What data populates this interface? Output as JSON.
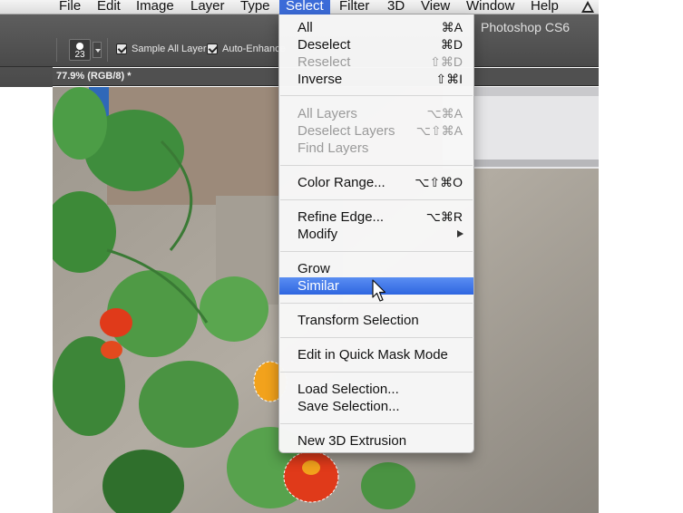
{
  "menubar": {
    "items": [
      "File",
      "Edit",
      "Image",
      "Layer",
      "Type",
      "Select",
      "Filter",
      "3D",
      "View",
      "Window",
      "Help"
    ],
    "active": "Select"
  },
  "app": {
    "title": "Photoshop CS6"
  },
  "options": {
    "brush_size": "23",
    "sample_all_layers": "Sample All Layers",
    "auto_enhance": "Auto-Enhance"
  },
  "document": {
    "tab_label": "77.9% (RGB/8) *"
  },
  "select_menu": {
    "items": [
      {
        "label": "All",
        "shortcut": "⌘A",
        "disabled": false
      },
      {
        "label": "Deselect",
        "shortcut": "⌘D",
        "disabled": false
      },
      {
        "label": "Reselect",
        "shortcut": "⇧⌘D",
        "disabled": true
      },
      {
        "label": "Inverse",
        "shortcut": "⇧⌘I",
        "disabled": false
      },
      {
        "label": "All Layers",
        "shortcut": "⌥⌘A",
        "disabled": true
      },
      {
        "label": "Deselect Layers",
        "shortcut": "⌥⇧⌘A",
        "disabled": true
      },
      {
        "label": "Find Layers",
        "shortcut": "",
        "disabled": true
      },
      {
        "label": "Color Range...",
        "shortcut": "⌥⇧⌘O",
        "disabled": false
      },
      {
        "label": "Refine Edge...",
        "shortcut": "⌥⌘R",
        "disabled": false
      },
      {
        "label": "Modify",
        "shortcut": "",
        "disabled": false,
        "submenu": true
      },
      {
        "label": "Grow",
        "shortcut": "",
        "disabled": false
      },
      {
        "label": "Similar",
        "shortcut": "",
        "disabled": false,
        "highlighted": true
      },
      {
        "label": "Transform Selection",
        "shortcut": "",
        "disabled": false
      },
      {
        "label": "Edit in Quick Mask Mode",
        "shortcut": "",
        "disabled": false
      },
      {
        "label": "Load Selection...",
        "shortcut": "",
        "disabled": false
      },
      {
        "label": "Save Selection...",
        "shortcut": "",
        "disabled": false
      },
      {
        "label": "New 3D Extrusion",
        "shortcut": "",
        "disabled": false
      }
    ]
  },
  "colors": {
    "menu_highlight": "#3b6bd8",
    "options_bar": "#4f4f4f",
    "leaf_green": "#4f9a45",
    "flower_red": "#e03a1a",
    "flower_orange": "#f2a21c"
  }
}
